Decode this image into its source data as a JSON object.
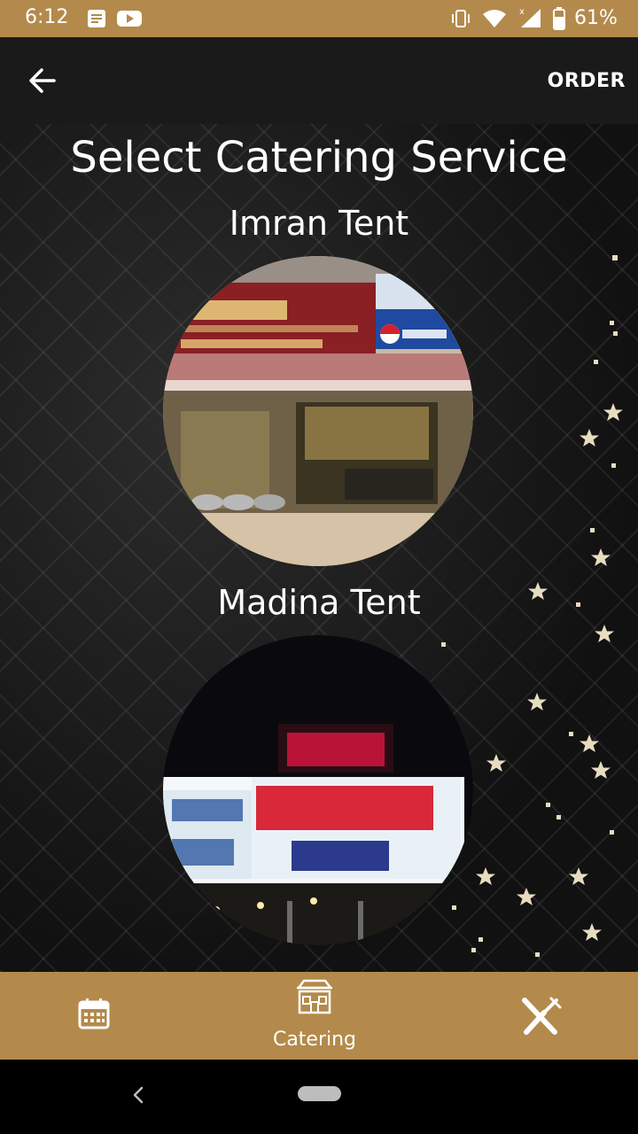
{
  "status_bar": {
    "time": "6:12",
    "battery_percent": "61%",
    "icons": [
      "notes-icon",
      "youtube-icon",
      "vibrate-icon",
      "wifi-icon",
      "cellular-signal-icon",
      "battery-icon"
    ]
  },
  "app_bar": {
    "back_icon": "arrow-left-icon",
    "action_label": "ORDER"
  },
  "main": {
    "title": "Select Catering Service",
    "vendors": [
      {
        "name": "Imran Tent"
      },
      {
        "name": "Madina Tent"
      }
    ]
  },
  "bottom_nav": {
    "items": [
      {
        "icon": "calendar-icon",
        "label": ""
      },
      {
        "icon": "catering-building-icon",
        "label": "Catering"
      },
      {
        "icon": "fork-knife-icon",
        "label": ""
      }
    ]
  },
  "colors": {
    "accent": "#b38a4c",
    "app_bar": "#1a1a1a",
    "background": "#151515"
  }
}
